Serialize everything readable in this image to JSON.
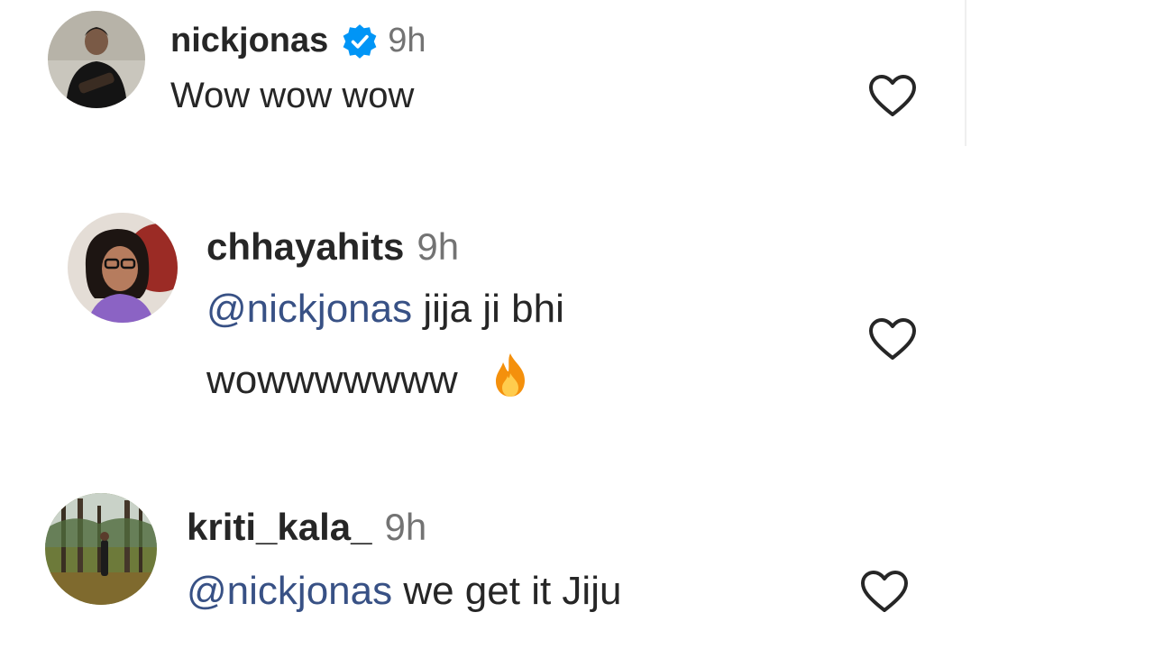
{
  "comments": [
    {
      "username": "nickjonas",
      "time": "9h",
      "verified": true,
      "text": "Wow wow wow",
      "avatar_icon": "user-avatar-photo"
    },
    {
      "username": "chhayahits",
      "time": "9h",
      "verified": false,
      "mention": "@nickjonas",
      "text_line1": " jija ji bhi",
      "text_line2": "wowwwwwww",
      "emoji": "fire-emoji",
      "avatar_icon": "user-avatar-photo"
    },
    {
      "username": "kriti_kala_",
      "time": "9h",
      "verified": false,
      "mention": "@nickjonas",
      "text": " we get it Jiju",
      "avatar_icon": "user-avatar-photo"
    }
  ],
  "icons": {
    "like": "heart-outline-icon",
    "verified": "verified-badge-icon"
  },
  "colors": {
    "text": "#262626",
    "secondary": "#737373",
    "mention": "#385185",
    "verified": "#0095f6",
    "heart_stroke": "#262626"
  }
}
